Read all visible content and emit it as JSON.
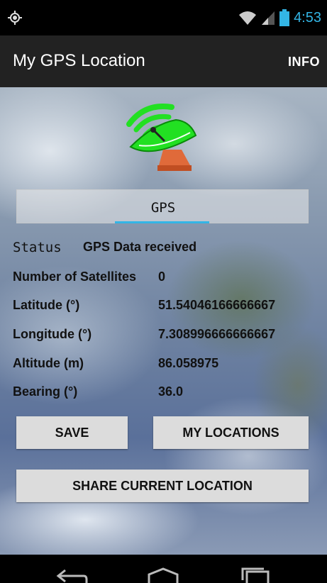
{
  "status_bar": {
    "time": "4:53"
  },
  "action_bar": {
    "title": "My GPS Location",
    "info_label": "INFO"
  },
  "tab": {
    "label": "GPS"
  },
  "fields": {
    "status": {
      "label": "Status",
      "value": "GPS Data received"
    },
    "satellites": {
      "label": "Number of Satellites",
      "value": "0"
    },
    "latitude": {
      "label": "Latitude (°)",
      "value": "51.54046166666667"
    },
    "longitude": {
      "label": "Longitude (°)",
      "value": "7.308996666666667"
    },
    "altitude": {
      "label": "Altitude (m)",
      "value": "86.058975"
    },
    "bearing": {
      "label": "Bearing (°)",
      "value": "36.0"
    }
  },
  "buttons": {
    "save": "SAVE",
    "my_locations": "MY LOCATIONS",
    "share": "SHARE CURRENT LOCATION"
  },
  "colors": {
    "accent": "#33b5e5",
    "dish_green": "#22e022",
    "base_orange": "#e06a3a"
  }
}
